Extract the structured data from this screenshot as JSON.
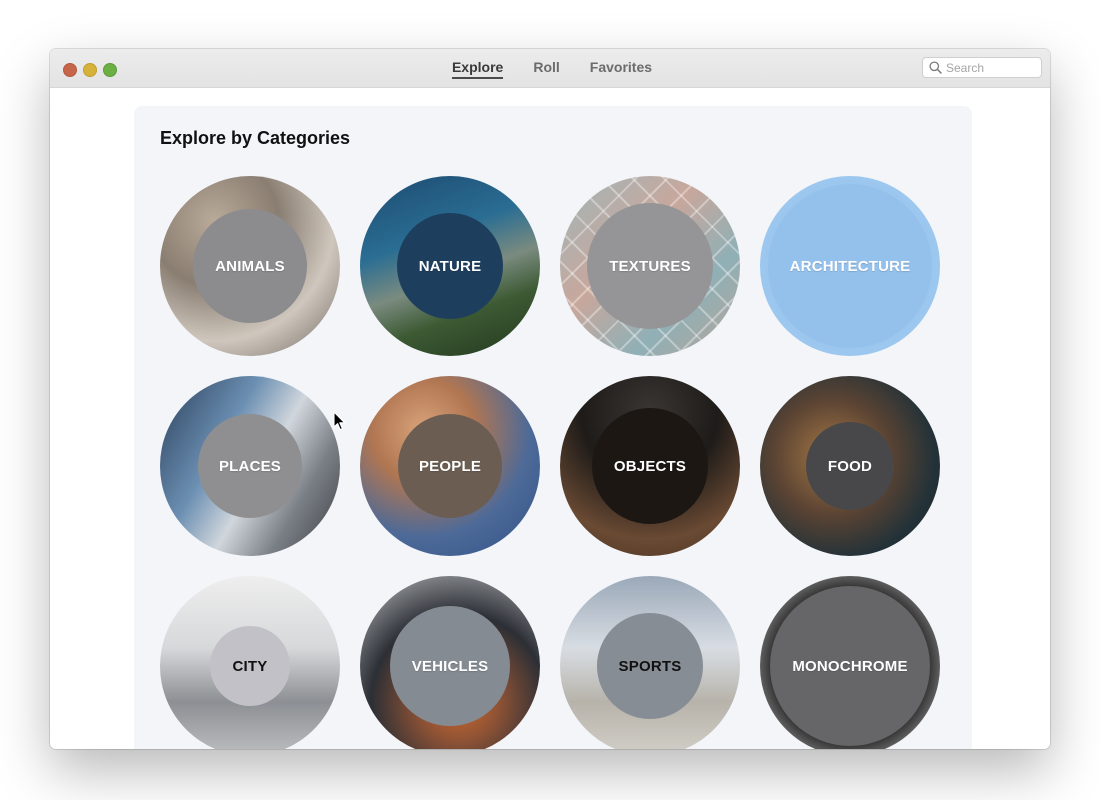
{
  "window": {
    "tabs": [
      {
        "label": "Explore",
        "active": true
      },
      {
        "label": "Roll",
        "active": false
      },
      {
        "label": "Favorites",
        "active": false
      }
    ],
    "search": {
      "placeholder": "Search",
      "value": ""
    }
  },
  "main": {
    "heading": "Explore by Categories",
    "categories": [
      {
        "label": "ANIMALS"
      },
      {
        "label": "NATURE"
      },
      {
        "label": "TEXTURES"
      },
      {
        "label": "ARCHITECTURE"
      },
      {
        "label": "PLACES"
      },
      {
        "label": "PEOPLE"
      },
      {
        "label": "OBJECTS"
      },
      {
        "label": "FOOD"
      },
      {
        "label": "CITY"
      },
      {
        "label": "VEHICLES"
      },
      {
        "label": "SPORTS"
      },
      {
        "label": "MONOCHROME"
      }
    ]
  },
  "colors": {
    "window_bg": "#ffffff",
    "panel_bg": "#f3f5f9",
    "titlebar": "#e6e6e6",
    "close": "#c7654a",
    "minimize": "#d6b23a",
    "maximize": "#6cb043"
  },
  "icons": {
    "search": "magnifier-icon",
    "cursor": "pointer-arrow"
  }
}
